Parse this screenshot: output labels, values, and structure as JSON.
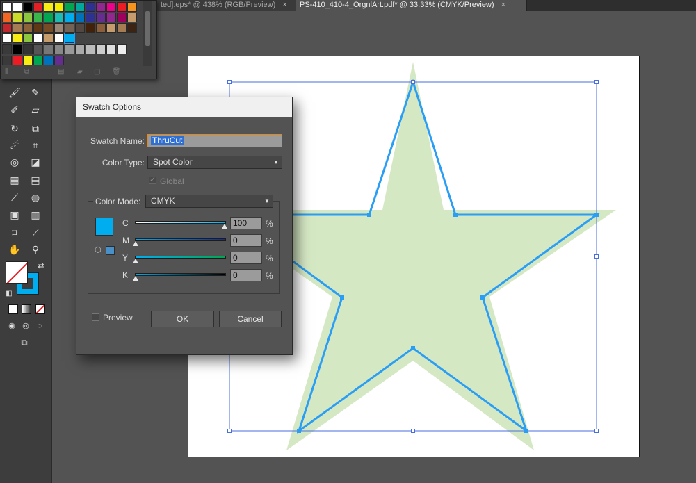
{
  "tabs": [
    {
      "label": "ted].eps* @ 438% (RGB/Preview)",
      "close": "×",
      "active": false
    },
    {
      "label": "PS-410_410-4_OrgnlArt.pdf* @ 33.33% (CMYK/Preview)",
      "close": "×",
      "active": true
    }
  ],
  "swatches": {
    "rows": [
      [
        "#ffffff",
        "#ffffff",
        "#000000",
        "#e31f26",
        "#f7ec13",
        "#f5ec00",
        "#00a650",
        "#00a99d",
        "#2e3192",
        "#92278f",
        "#ec008c",
        "#ed1c24",
        "#f7941d"
      ],
      [
        "#f26522",
        "#cbdb2a",
        "#8dc63f",
        "#39b54a",
        "#00a651",
        "#1cbbb4",
        "#00aeef",
        "#0072bc",
        "#2e3192",
        "#662d91",
        "#92278f",
        "#9e005d",
        "#c69c6d"
      ],
      [
        "#c1272d",
        "#a67c52",
        "#8c6239",
        "#603813",
        "#754c24",
        "#998675",
        "#736357",
        "#534741",
        "#42210b",
        "#8b5e3c",
        "#c69c6d",
        "#a67c52",
        "#3c2415"
      ]
    ],
    "accent": "#2a9df4"
  },
  "dialog": {
    "title": "Swatch Options",
    "swatch_name_label": "Swatch Name:",
    "swatch_name": "ThruCut",
    "color_type_label": "Color Type:",
    "color_type": "Spot Color",
    "global_label": "Global",
    "color_mode_label": "Color Mode:",
    "color_mode": "CMYK",
    "preview_color": "#00aeef",
    "channels": [
      {
        "label": "C",
        "value": "100",
        "unit": "%"
      },
      {
        "label": "M",
        "value": "0",
        "unit": "%"
      },
      {
        "label": "Y",
        "value": "0",
        "unit": "%"
      },
      {
        "label": "K",
        "value": "0",
        "unit": "%"
      }
    ],
    "preview_label": "Preview",
    "ok": "OK",
    "cancel": "Cancel"
  },
  "artwork": {
    "star_fill": "#d5e8c4",
    "path_color": "#2a9df4",
    "bbox_color": "#4a6ee0"
  }
}
